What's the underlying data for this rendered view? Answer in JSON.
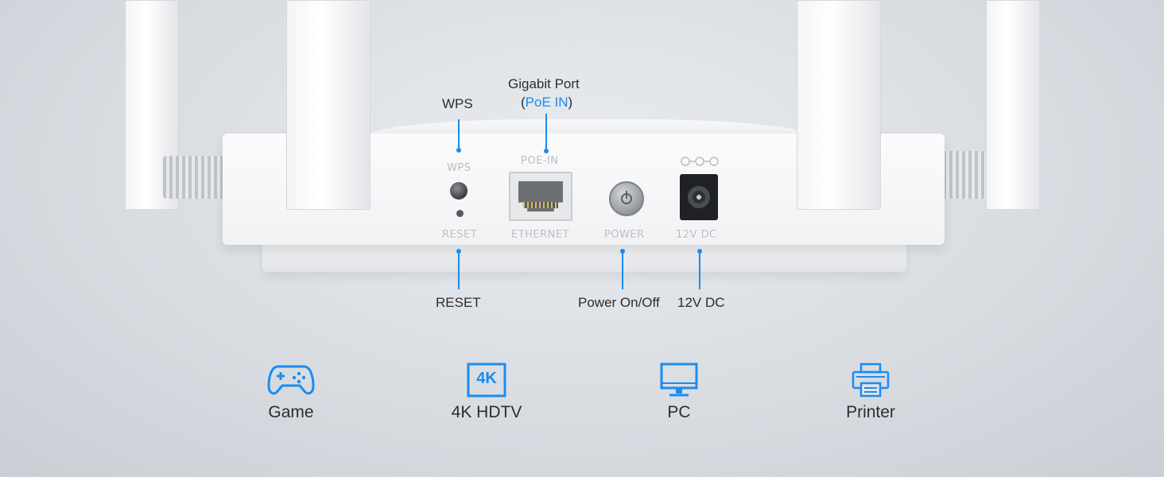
{
  "router": {
    "panel_labels": {
      "wps": "WPS",
      "reset": "RESET",
      "poe_in": "POE-IN",
      "ethernet": "ETHERNET",
      "power": "POWER",
      "dc": "12V DC"
    }
  },
  "callouts": {
    "wps": "WPS",
    "gigabit_line1": "Gigabit Port",
    "gigabit_open": "(",
    "gigabit_poe": "PoE IN",
    "gigabit_close": ")",
    "reset": "RESET",
    "power": "Power On/Off",
    "dc": "12V DC"
  },
  "devices": [
    {
      "label": "Game",
      "icon": "gamepad-icon"
    },
    {
      "label": "4K HDTV",
      "icon": "4k-tv-icon",
      "badge": "4K"
    },
    {
      "label": "PC",
      "icon": "monitor-icon"
    },
    {
      "label": "Printer",
      "icon": "printer-icon"
    }
  ],
  "colors": {
    "accent": "#1a8cf0",
    "text": "#2b2d30",
    "background": "#d9dde2"
  }
}
